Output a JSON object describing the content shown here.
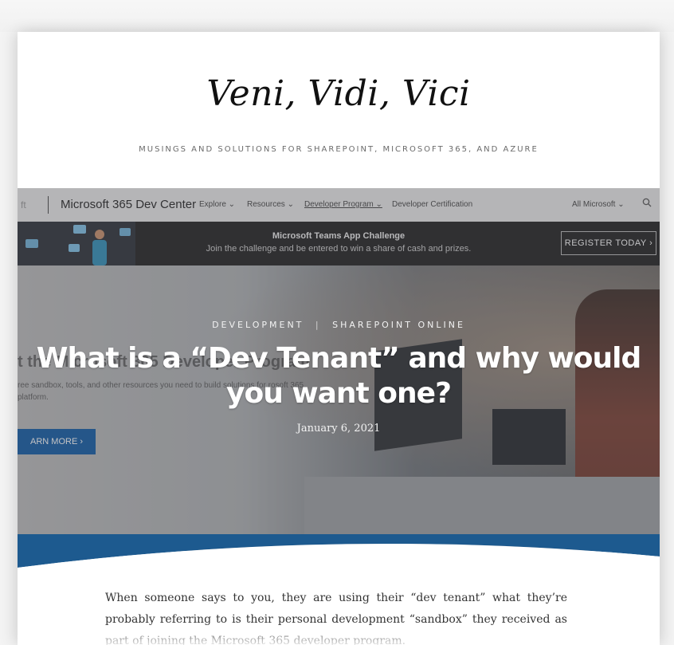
{
  "blog": {
    "title": "Veni, Vidi, Vici",
    "tagline": "MUSINGS AND SOLUTIONS FOR SHAREPOINT, MICROSOFT 365, AND AZURE"
  },
  "hero_image": {
    "nav": {
      "brand_stub": "ft",
      "brand": "Microsoft 365 Dev Center",
      "items": [
        "Explore ⌄",
        "Resources ⌄",
        "Developer Program ⌄",
        "Developer Certification"
      ],
      "right_item": "All Microsoft ⌄"
    },
    "banner": {
      "title": "Microsoft Teams App Challenge",
      "subtitle": "Join the challenge and be entered to win a share of cash and prizes.",
      "button": "REGISTER TODAY ›"
    },
    "ghost": {
      "title": "t the Microsoft 365 Developer Program",
      "subtitle": "ree sandbox, tools, and other resources you need to build solutions for rosoft 365 platform.",
      "button": "ARN MORE ›"
    }
  },
  "post": {
    "categories": [
      "DEVELOPMENT",
      "SHAREPOINT ONLINE"
    ],
    "separator": "|",
    "title": "What is a “Dev Tenant” and why would you want one?",
    "date": "January 6, 2021",
    "excerpt": "When someone says to you, they are using their “dev tenant” what they’re probably referring to is their personal development “sandbox” they received as part of joining the Microsoft 365 developer program."
  },
  "colors": {
    "accent_blue": "#0f5aa5",
    "curve_blue": "#1d5a8f"
  }
}
